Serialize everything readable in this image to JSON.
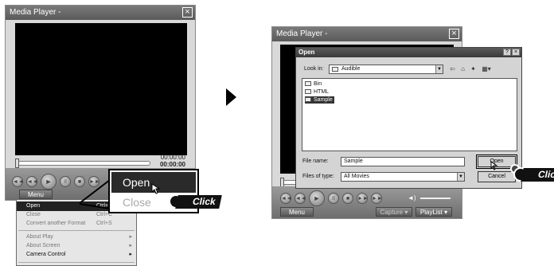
{
  "left_window": {
    "title": "Media Player -",
    "close_glyph": "×",
    "time_elapsed": "00:00:00",
    "time_total": "00:00:00",
    "menu_button_label": "Menu",
    "controls": {
      "prev": "◄◄",
      "rewind": "◄◄",
      "play": "►",
      "pause": "II",
      "stop": "■",
      "ff": "►►"
    }
  },
  "context_menu": {
    "items": [
      {
        "label": "Open",
        "shortcut": "Ctrl+O",
        "selected": true
      },
      {
        "label": "Close",
        "shortcut": "Ctrl+C"
      },
      {
        "label": "Convert another Format",
        "shortcut": "Ctrl+S"
      },
      {
        "label": "About Play",
        "submenu": true
      },
      {
        "label": "About Screen",
        "submenu": true
      },
      {
        "label": "Camera Control",
        "submenu": true,
        "bold": true
      }
    ],
    "submenu_glyph": "▸"
  },
  "zoom_callout": {
    "open_label": "Open",
    "close_label": "Close"
  },
  "click_label": "Click",
  "right_window": {
    "title": "Media Player -",
    "close_glyph": "×",
    "menu_button_label": "Menu",
    "capture_label": "Capture ▾",
    "playlist_label": "PlayList ▾",
    "volume_icon": "◄)"
  },
  "open_dialog": {
    "title": "Open",
    "help_glyph": "?",
    "close_glyph": "×",
    "look_in_label": "Look in:",
    "look_in_value": "Audible",
    "toolbar_icons": [
      "back-icon",
      "up-folder-icon",
      "new-folder-icon",
      "view-menu-icon"
    ],
    "toolbar_glyphs": [
      "⇦",
      "⌂",
      "✦",
      "▦▾"
    ],
    "files": [
      {
        "name": "Bin",
        "selected": false
      },
      {
        "name": "HTML",
        "selected": false
      },
      {
        "name": "Sample",
        "selected": true
      }
    ],
    "file_name_label": "File name:",
    "file_name_value": "Sample",
    "file_type_label": "Files of type:",
    "file_type_value": "All Movies",
    "open_button": "Open",
    "cancel_button": "Cancel"
  }
}
